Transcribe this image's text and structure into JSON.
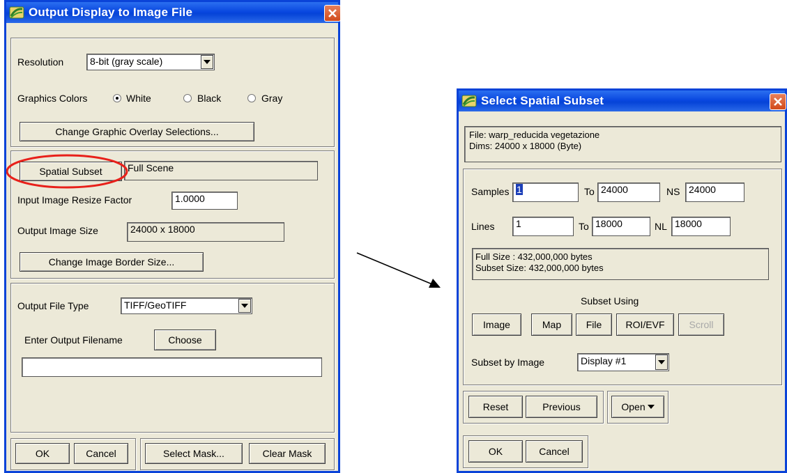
{
  "left_window": {
    "title": "Output Display to Image File",
    "resolution": {
      "label": "Resolution",
      "value": "8-bit (gray scale)"
    },
    "graphics_colors": {
      "label": "Graphics Colors",
      "options": [
        "White",
        "Black",
        "Gray"
      ],
      "selected": "White"
    },
    "overlay_button": "Change Graphic Overlay Selections...",
    "spatial_subset_button": "Spatial Subset",
    "spatial_subset_value": "Full Scene",
    "resize_factor": {
      "label": "Input Image Resize Factor",
      "value": "1.0000"
    },
    "output_size": {
      "label": "Output Image Size",
      "value": "24000 x 18000"
    },
    "border_button": "Change Image Border Size...",
    "file_type": {
      "label": "Output File Type",
      "value": "TIFF/GeoTIFF"
    },
    "filename": {
      "label": "Enter Output Filename",
      "choose_button": "Choose",
      "value": ""
    },
    "buttons": {
      "ok": "OK",
      "cancel": "Cancel",
      "select_mask": "Select Mask...",
      "clear_mask": "Clear Mask"
    }
  },
  "right_window": {
    "title": "Select Spatial Subset",
    "file_info": {
      "file": "File: warp_reducida vegetazione",
      "dims": "Dims: 24000 x 18000 (Byte)"
    },
    "samples": {
      "label": "Samples",
      "from": "1",
      "to_label": "To",
      "to": "24000",
      "ns_label": "NS",
      "ns": "24000"
    },
    "lines": {
      "label": "Lines",
      "from": "1",
      "to_label": "To",
      "to": "18000",
      "nl_label": "NL",
      "nl": "18000"
    },
    "size_info": {
      "full": "Full Size  : 432,000,000 bytes",
      "subset": "Subset Size: 432,000,000 bytes"
    },
    "subset_using": {
      "label": "Subset Using",
      "buttons": [
        "Image",
        "Map",
        "File",
        "ROI/EVF",
        "Scroll"
      ]
    },
    "subset_by_image": {
      "label": "Subset by Image",
      "value": "Display #1"
    },
    "buttons": {
      "reset": "Reset",
      "previous": "Previous",
      "open": "Open",
      "ok": "OK",
      "cancel": "Cancel"
    }
  },
  "colors": {
    "title_bar": "#0a48e0",
    "window_bg": "#ece9d8",
    "highlight_ellipse": "#e8201a",
    "close_button": "#d24a1a"
  }
}
